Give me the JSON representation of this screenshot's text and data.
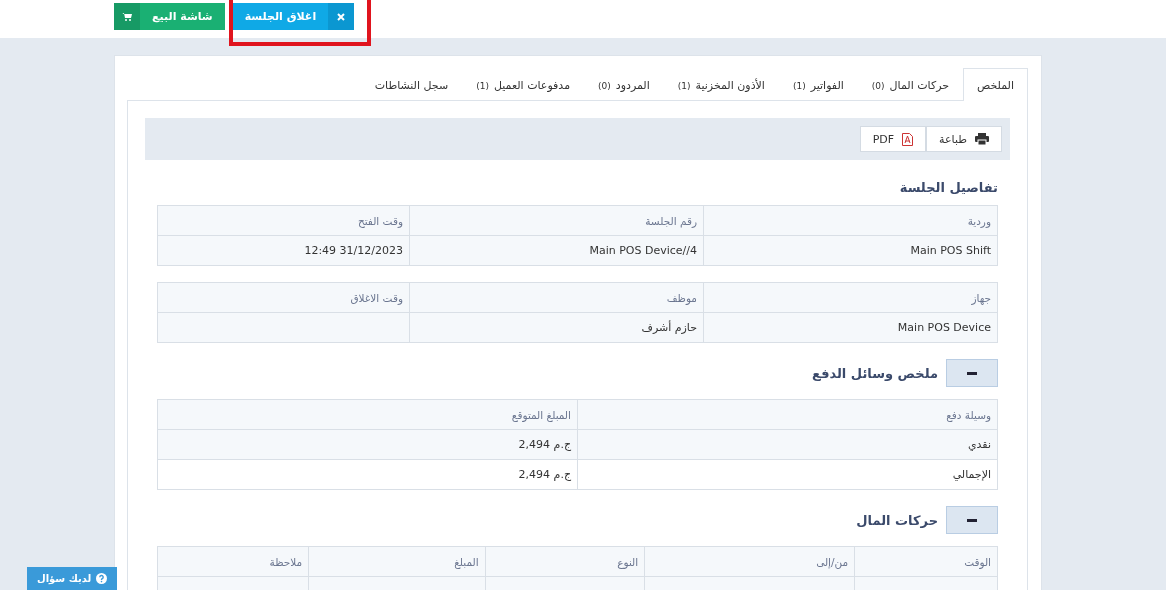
{
  "top_bar": {
    "buttons": [
      {
        "label": "اغلاق الجلسة",
        "kind": "close",
        "highlighted": true
      },
      {
        "label": "شاشة البيع",
        "kind": "pos",
        "highlighted": false
      }
    ]
  },
  "tabs": [
    {
      "label": "الملخص",
      "selected": true
    },
    {
      "label": "حركات المال",
      "count": "(0)",
      "selected": false
    },
    {
      "label": "الفواتير",
      "count": "(1)",
      "selected": false
    },
    {
      "label": "الأذون المخزنية",
      "count": "(1)",
      "selected": false
    },
    {
      "label": "المردود",
      "count": "(0)",
      "selected": false
    },
    {
      "label": "مدفوعات العميل",
      "count": "(1)",
      "selected": false
    },
    {
      "label": "سجل النشاطات",
      "selected": false
    }
  ],
  "toolbar": [
    {
      "label": "طباعة",
      "kind": "print"
    },
    {
      "label": "PDF",
      "kind": "pdf"
    }
  ],
  "sections": [
    {
      "title": "تفاصيل الجلسة",
      "tables": [
        {
          "columns": [
            "وردية",
            "رقم الجلسة",
            "وقت الفتح"
          ],
          "rows": [
            {
              "cells": [
                "Main POS Shift",
                "Main POS Device//4",
                "31/12/2023 12:49"
              ]
            }
          ]
        },
        {
          "columns": [
            "جهاز",
            "موظف",
            "وقت الاغلاق"
          ],
          "rows": [
            {
              "cells": [
                "Main POS Device",
                "حازم أشرف",
                ""
              ]
            }
          ]
        }
      ]
    },
    {
      "title": "ملخص وسائل الدفع",
      "expanded": true,
      "tables": [
        {
          "columns": [
            "وسيلة دفع",
            "المبلغ المتوقع"
          ],
          "rows": [
            {
              "cells": [
                "نقدي",
                "ج.م 2,494"
              ]
            },
            {
              "cells": [
                "الإجمالي",
                "ج.م 2,494"
              ]
            }
          ]
        }
      ]
    },
    {
      "title": "حركات المال",
      "expanded": true,
      "tables": [
        {
          "columns": [
            "الوقت",
            "من/إلى",
            "النوع",
            "المبلغ",
            "ملاحظة"
          ]
        }
      ]
    }
  ],
  "help_button": {
    "label": "لديك سؤال"
  }
}
